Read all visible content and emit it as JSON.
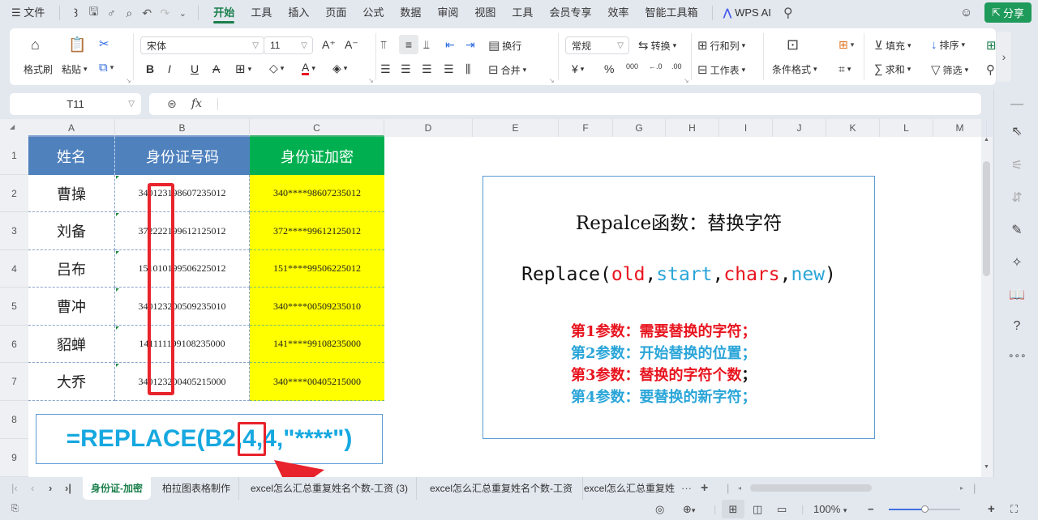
{
  "menubar": {
    "menu_label": "文件",
    "tabs": [
      "开始",
      "工具",
      "插入",
      "页面",
      "公式",
      "数据",
      "审阅",
      "视图",
      "工具",
      "会员专享",
      "效率",
      "智能工具箱"
    ],
    "active_tab": "开始",
    "ai_label": "WPS AI",
    "share_label": "分享"
  },
  "ribbon": {
    "format_painter": "格式刷",
    "paste": "粘贴",
    "font_name": "宋体",
    "font_size": "11",
    "bold": "B",
    "italic": "I",
    "underline": "U",
    "wrap": "换行",
    "merge": "合并",
    "number_format": "常规",
    "convert": "转换",
    "rows_cols": "行和列",
    "worksheet": "工作表",
    "conditional_format": "条件格式",
    "fill": "填充",
    "sort": "排序",
    "sum": "求和",
    "filter": "筛选",
    "currency": "¥",
    "percent": "%",
    "thousands": "000",
    "font_color": "#e8141e"
  },
  "formula_bar": {
    "cell_ref": "T11",
    "fx": "fx",
    "content": ""
  },
  "columns": [
    "A",
    "B",
    "C",
    "D",
    "E",
    "F",
    "G",
    "H",
    "I",
    "J",
    "K",
    "L",
    "M"
  ],
  "rows": [
    "1",
    "2",
    "3",
    "4",
    "5",
    "6",
    "7",
    "8",
    "9"
  ],
  "table": {
    "headers": [
      "姓名",
      "身份证号码",
      "身份证加密"
    ],
    "header_colors": [
      "#4f81bd",
      "#4f81bd",
      "#00b050"
    ],
    "rows": [
      {
        "name": "曹操",
        "id": "340123198607235012",
        "enc": "340****98607235012"
      },
      {
        "name": "刘备",
        "id": "372222199612125012",
        "enc": "372****99612125012"
      },
      {
        "name": "吕布",
        "id": "151010199506225012",
        "enc": "151****99506225012"
      },
      {
        "name": "曹冲",
        "id": "340123200509235010",
        "enc": "340****00509235010"
      },
      {
        "name": "貂蝉",
        "id": "141111199108235000",
        "enc": "141****99108235000"
      },
      {
        "name": "大乔",
        "id": "340123200405215000",
        "enc": "340****00405215000"
      }
    ]
  },
  "formula_example": {
    "before": "=REPLACE(B2,4,",
    "highlight": "4,",
    "after": "\"****\")"
  },
  "info_box": {
    "title": "Repalce函数：替换字符",
    "syntax": {
      "func": "Replace(",
      "p1": "old",
      "p2": "start",
      "p3": "chars",
      "p4": "new",
      "comma": ",",
      "close": ")"
    },
    "lines": [
      {
        "text": "第1参数：需要替换的字符；",
        "color": "red"
      },
      {
        "text": "第2参数：开始替换的位置；",
        "color": "blue"
      },
      {
        "text": "第3参数：替换的字符个数",
        "suffix": "；",
        "color": "red"
      },
      {
        "text": "第4参数：要替换的新字符；",
        "color": "blue"
      }
    ]
  },
  "sheet_tabs": [
    {
      "label": "身份证-加密",
      "active": true
    },
    {
      "label": "柏拉图表格制作",
      "active": false
    },
    {
      "label": "excel怎么汇总重复姓名个数-工资 (3)",
      "active": false
    },
    {
      "label": "excel怎么汇总重复姓名个数-工资",
      "active": false
    },
    {
      "label": "excel怎么汇总重复姓",
      "active": false
    }
  ],
  "statusbar": {
    "zoom": "100%",
    "zoom_level_fraction": 0.5
  },
  "colors": {
    "accent": "#1a7f4b",
    "highlight_red": "#e8232b",
    "formula_blue": "#16a8e0",
    "encrypted_bg": "#ffff00"
  }
}
